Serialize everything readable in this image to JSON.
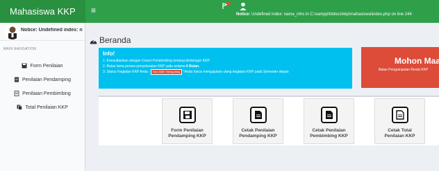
{
  "header": {
    "brand": "Mahasiswa KKP",
    "toggle_icon": "hamburger-icon",
    "notice_prefix": "Notice:",
    "notice_text": " Undefined index: nama_mhs in C:\\xampp\\htdocs\\kkp\\mahasiswa\\index.php on line 244"
  },
  "sidebar": {
    "user_notice": "Notice: Undefined index: n",
    "nav_header": "MAIN NAVIGATION",
    "items": [
      {
        "label": "Form Penilaian",
        "icon": "save-icon"
      },
      {
        "label": "Penilaian Pendamping",
        "icon": "document-icon"
      },
      {
        "label": "Penilaian Pembimbing",
        "icon": "document-outline-icon"
      },
      {
        "label": "Total Penilaian KKP",
        "icon": "copy-icon"
      }
    ]
  },
  "main": {
    "page_title": "Beranda",
    "info": {
      "title": "Info!",
      "line1": "1. Konsultasikan dengan Dosen Pembimbing tentang bimbingan KKP.",
      "line2_prefix": "2. Batas lama proses penyelesaian KKP yaitu selama ",
      "line2_bold": "6 Bulan.",
      "line3_prefix": "3. Status Kegiatan KKP Anda : ",
      "status_badge": "Non Aktif / Mengulang",
      "line3_suffix": " *Anda harus mengajukan ulang kegiatan KKP pada Semester depan"
    },
    "alert": {
      "title": "Mohon Maa",
      "subtitle": "Batas Pengumpulan Revisi KKP"
    },
    "tiles": [
      {
        "label_1": "Form Penilaian",
        "label_2": "Pendamping KKP",
        "icon": "save-icon"
      },
      {
        "label_1": "Cetak Penilaian",
        "label_2": "Pendamping KKP",
        "icon": "file-icon"
      },
      {
        "label_1": "Cetak Penilaian",
        "label_2": "Pembimbing KKP",
        "icon": "file-icon"
      },
      {
        "label_1": "Cetak Total",
        "label_2": "Penilaian KKP",
        "icon": "file-outline-icon"
      }
    ]
  },
  "colors": {
    "header_green": "#2ea04a",
    "brand_green": "#28903f",
    "info_blue": "#00c0ef",
    "alert_red": "#dd4b39"
  }
}
